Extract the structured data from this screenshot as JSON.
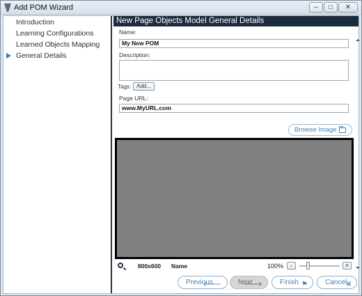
{
  "window": {
    "title": "Add POM Wizard",
    "minimize": "–",
    "maximize": "□",
    "close": "✕"
  },
  "nav": {
    "items": [
      {
        "label": "Introduction",
        "active": false
      },
      {
        "label": "Learning Configurations",
        "active": false
      },
      {
        "label": "Learned Objects Mapping",
        "active": false
      },
      {
        "label": "General Details",
        "active": true
      }
    ]
  },
  "panel": {
    "header": "New Page Objects Model General Details",
    "name_label": "Name:",
    "name_value": "My New POM",
    "description_label": "Description:",
    "description_value": "",
    "tags_label": "Tags:",
    "tags_add": "Add...",
    "url_label": "Page URL:",
    "url_value": "www.MyURL.com",
    "browse_label": "Browse Image"
  },
  "info_bar": {
    "size": "800x600",
    "name": "Name",
    "zoom": "100%",
    "zoom_minus": "-",
    "zoom_plus": "+",
    "zoom_level": 0.18
  },
  "footer": {
    "previous": "Previous",
    "next": "Next",
    "finish": "Finish",
    "cancel": "Cancel"
  },
  "colors": {
    "header_bg": "#1c2b3d",
    "accent": "#4a7fb5",
    "screenshot_bg": "#808080"
  }
}
